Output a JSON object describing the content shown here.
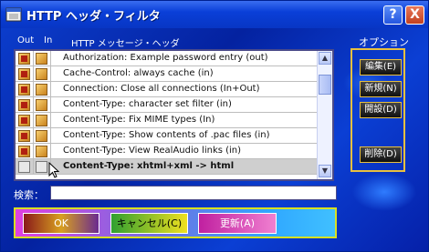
{
  "window": {
    "title": "HTTP ヘッダ・フィルタ"
  },
  "titlebar_buttons": {
    "help": "?",
    "close": "X"
  },
  "headers": {
    "out": "Out",
    "in": "In",
    "message": "HTTP メッセージ・ヘッダ"
  },
  "rows": [
    {
      "text": "Authorization: Example password entry (out)",
      "out": true,
      "in": true,
      "selected": false
    },
    {
      "text": "Cache-Control: always cache (in)",
      "out": true,
      "in": true,
      "selected": false
    },
    {
      "text": "Connection: Close all connections (In+Out)",
      "out": true,
      "in": true,
      "selected": false
    },
    {
      "text": "Content-Type: character set filter (in)",
      "out": true,
      "in": true,
      "selected": false
    },
    {
      "text": "Content-Type: Fix MIME types (In)",
      "out": true,
      "in": true,
      "selected": false
    },
    {
      "text": "Content-Type: Show contents of .pac files (in)",
      "out": true,
      "in": true,
      "selected": false
    },
    {
      "text": "Content-Type: View RealAudio links (in)",
      "out": true,
      "in": true,
      "selected": false
    },
    {
      "text": "Content-Type: xhtml+xml -> html",
      "out": false,
      "in": false,
      "selected": true
    }
  ],
  "search": {
    "label": "検索：",
    "value": ""
  },
  "options": {
    "label": "オプション",
    "edit": "編集(E)",
    "new": "新規(N)",
    "open": "開設(D)",
    "delete": "削除(D)"
  },
  "buttons": {
    "ok": "OK",
    "cancel": "キャンセル(C)",
    "update": "更新(A)"
  },
  "colors": {
    "titlebar": "#0a3fd8",
    "accent_yellow": "#e8c040",
    "list_selected": "#cfcfcf"
  }
}
